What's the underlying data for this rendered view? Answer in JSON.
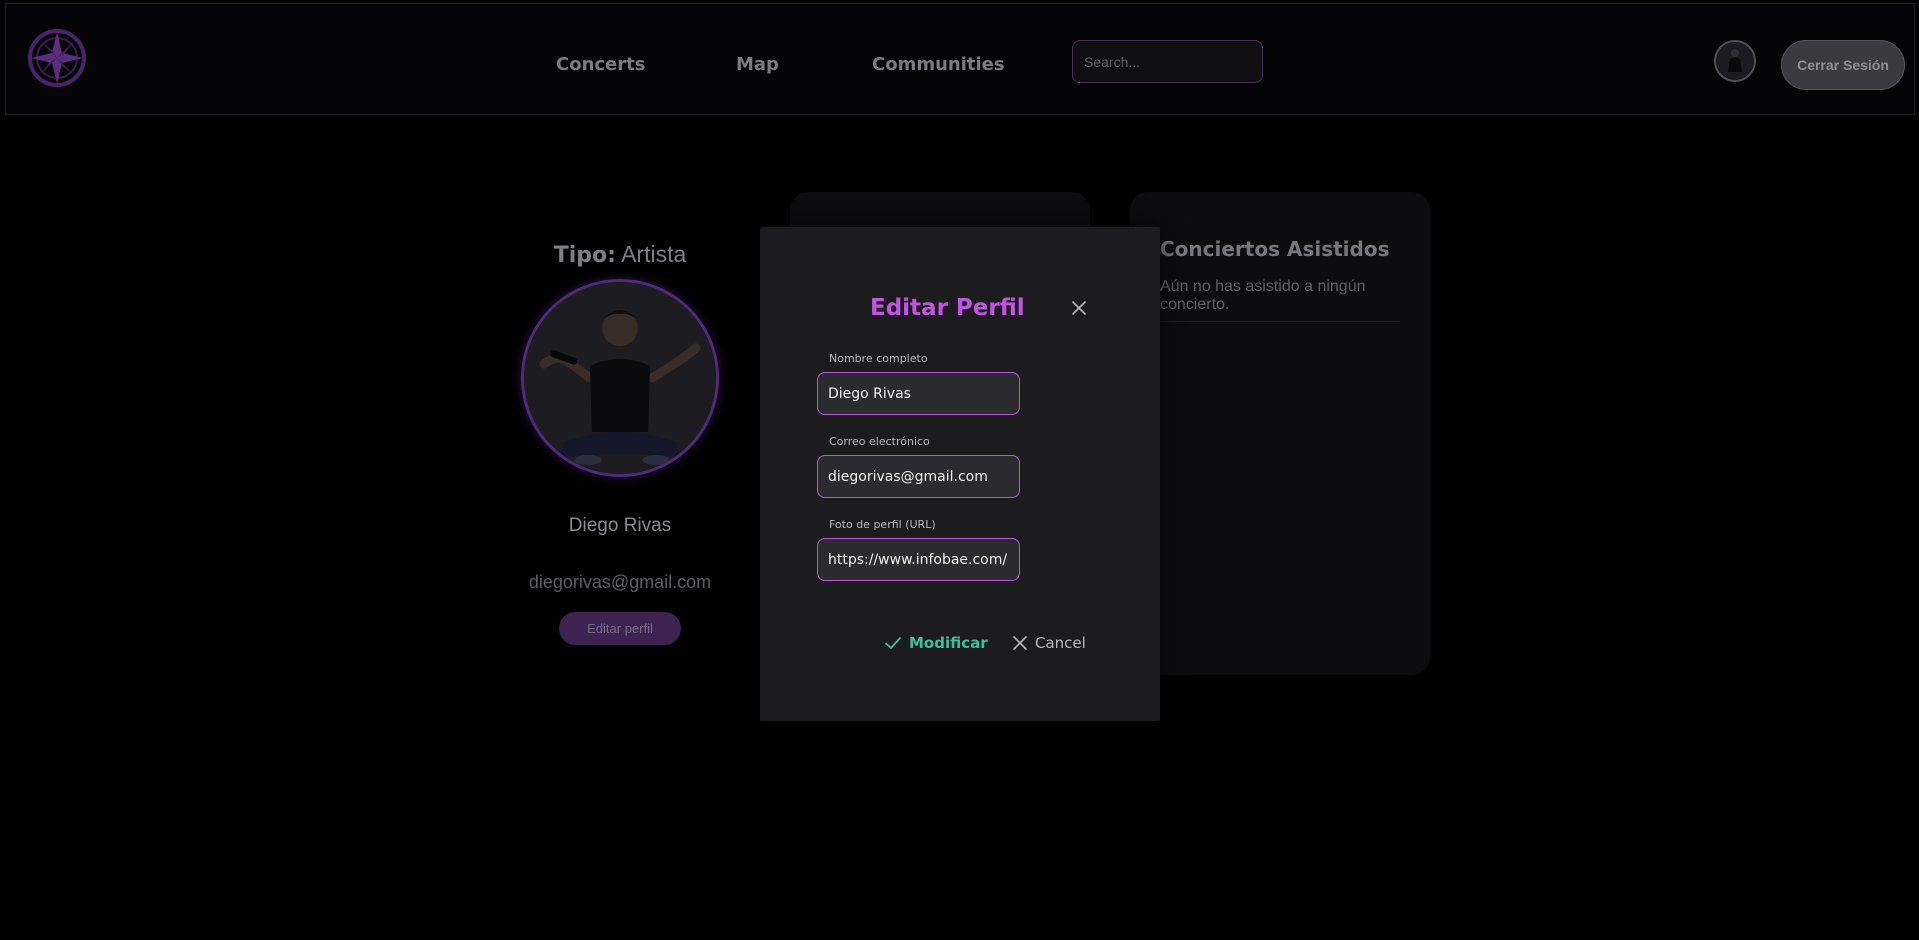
{
  "navbar": {
    "links": [
      "Concerts",
      "Map",
      "Communities"
    ],
    "search_placeholder": "Search...",
    "logout_label": "Cerrar Sesión"
  },
  "profile": {
    "type_label": "Tipo:",
    "type_value": "Artista",
    "name": "Diego Rivas",
    "email": "diegorivas@gmail.com",
    "edit_button_label": "Editar perfil"
  },
  "concerts_card": {
    "title": "Conciertos Asistidos",
    "empty_message": "Aún no has asistido a ningún concierto."
  },
  "modal": {
    "title": "Editar Perfil",
    "fields": [
      {
        "label": "Nombre completo",
        "value": "Diego Rivas"
      },
      {
        "label": "Correo electrónico",
        "value": "diegorivas@gmail.com"
      },
      {
        "label": "Foto de perfil (URL)",
        "value": "https://www.infobae.com/"
      }
    ],
    "modify_label": "Modificar",
    "cancel_label": "Cancel"
  },
  "colors": {
    "accent_purple": "#c055e0",
    "confirm_green": "#3fbf95",
    "background": "#000000",
    "modal_background": "#1c1c1f"
  }
}
